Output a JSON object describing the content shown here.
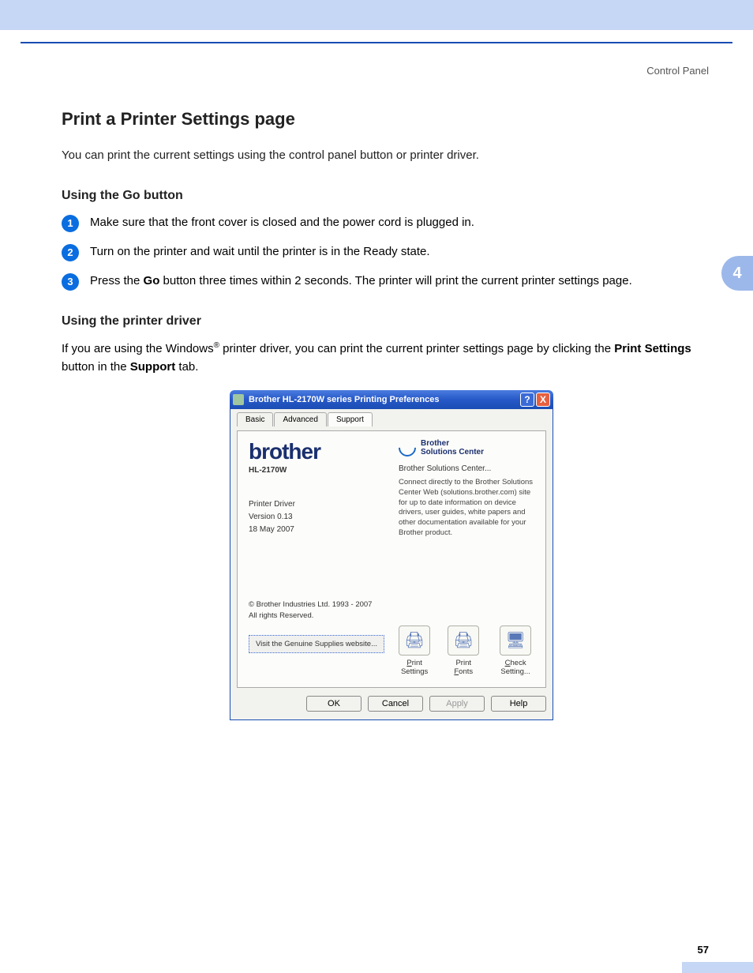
{
  "header_label": "Control Panel",
  "chapter_tab": "4",
  "page_number": "57",
  "h1": "Print a Printer Settings page",
  "intro": "You can print the current settings using the control panel button or printer driver.",
  "sub1_heading": "Using the Go button",
  "steps": {
    "s1": "Make sure that the front cover is closed and the power cord is plugged in.",
    "s2": "Turn on the printer and wait until the printer is in the Ready state.",
    "s3_pre": "Press the ",
    "s3_bold": "Go",
    "s3_post": " button three times within 2 seconds. The printer will print the current printer settings page."
  },
  "sub2_heading": "Using the printer driver",
  "para2": {
    "pre": "If you are using the Windows",
    "sup": "®",
    "mid": " printer driver, you can print the current printer settings page by clicking the ",
    "b1": "Print Settings",
    "mid2": " button in the ",
    "b2": "Support",
    "post": " tab."
  },
  "dialog": {
    "title": "Brother HL-2170W series Printing Preferences",
    "help_btn": "?",
    "close_btn": "X",
    "tabs": {
      "basic": "Basic",
      "advanced": "Advanced",
      "support": "Support"
    },
    "brand_logo": "brother",
    "model": "HL-2170W",
    "driver_label": "Printer Driver",
    "driver_version": "Version 0.13",
    "driver_date": "18 May 2007",
    "copyright1": "© Brother Industries Ltd. 1993 - 2007",
    "copyright2": "All rights Reserved.",
    "supplies_btn": "Visit the Genuine Supplies website...",
    "sol_brand1": "Brother",
    "sol_brand2": "Solutions Center",
    "sol_link": "Brother Solutions Center...",
    "sol_desc": "Connect directly to the Brother Solutions Center Web (solutions.brother.com) site for up to date information on device drivers, user guides, white papers and other documentation available for your Brother product.",
    "icon_print_settings": "Print Settings",
    "icon_print_fonts": "Print Fonts",
    "icon_check_setting": "Check Setting...",
    "btn_ok": "OK",
    "btn_cancel": "Cancel",
    "btn_apply": "Apply",
    "btn_help": "Help"
  }
}
